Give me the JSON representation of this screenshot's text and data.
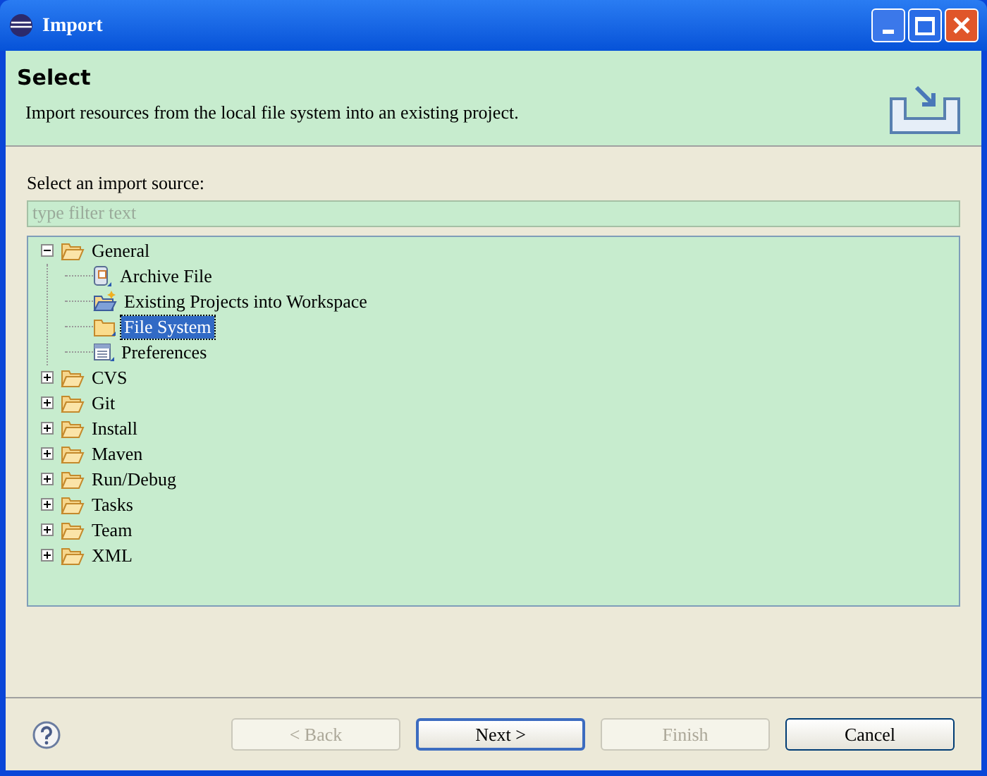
{
  "window": {
    "title": "Import"
  },
  "header": {
    "title": "Select",
    "description": "Import resources from the local file system into an existing project."
  },
  "source_label": "Select an import source:",
  "filter": {
    "placeholder": "type filter text"
  },
  "tree": [
    {
      "label": "General",
      "kind": "folder",
      "expanded": true,
      "selected": false,
      "children": [
        {
          "label": "Archive File",
          "kind": "archive",
          "selected": false
        },
        {
          "label": "Existing Projects into Workspace",
          "kind": "project",
          "selected": false
        },
        {
          "label": "File System",
          "kind": "folder-closed",
          "selected": true
        },
        {
          "label": "Preferences",
          "kind": "list",
          "selected": false
        }
      ]
    },
    {
      "label": "CVS",
      "kind": "folder",
      "expanded": false,
      "selected": false
    },
    {
      "label": "Git",
      "kind": "folder",
      "expanded": false,
      "selected": false
    },
    {
      "label": "Install",
      "kind": "folder",
      "expanded": false,
      "selected": false
    },
    {
      "label": "Maven",
      "kind": "folder",
      "expanded": false,
      "selected": false
    },
    {
      "label": "Run/Debug",
      "kind": "folder",
      "expanded": false,
      "selected": false
    },
    {
      "label": "Tasks",
      "kind": "folder",
      "expanded": false,
      "selected": false
    },
    {
      "label": "Team",
      "kind": "folder",
      "expanded": false,
      "selected": false
    },
    {
      "label": "XML",
      "kind": "folder",
      "expanded": false,
      "selected": false
    }
  ],
  "buttons": [
    {
      "label": "< Back",
      "disabled": true,
      "default": false
    },
    {
      "label": "Next >",
      "disabled": false,
      "default": true
    },
    {
      "label": "Finish",
      "disabled": true,
      "default": false
    },
    {
      "label": "Cancel",
      "disabled": false,
      "default": false
    }
  ]
}
